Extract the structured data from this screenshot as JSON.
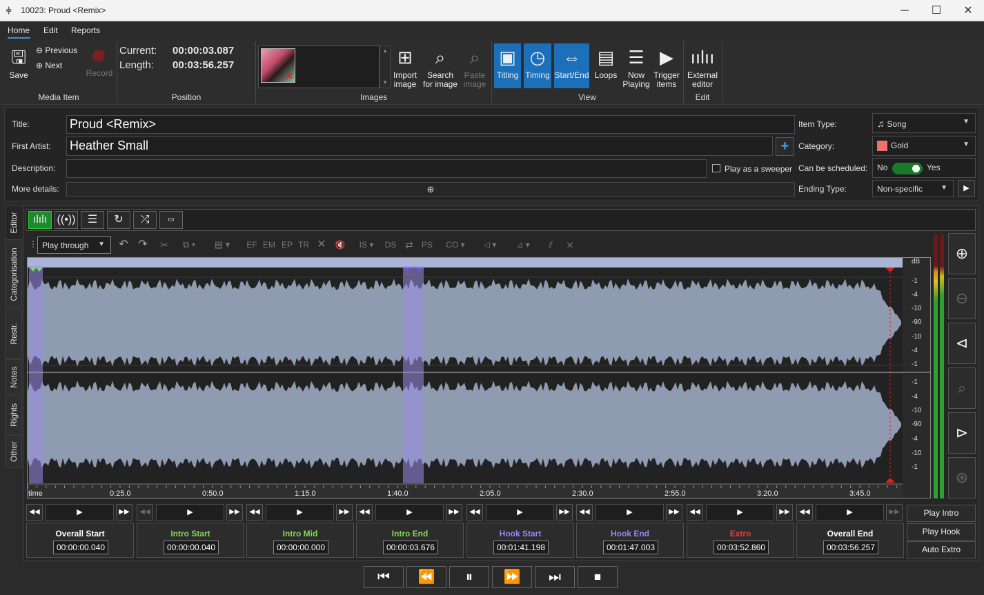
{
  "window": {
    "title": "10023: Proud <Remix>"
  },
  "menu": [
    "Home",
    "Edit",
    "Reports"
  ],
  "ribbon": {
    "save": "Save",
    "previous": "Previous",
    "next": "Next",
    "record": "Record",
    "group_media": "Media Item",
    "current_label": "Current:",
    "current_value": "00:00:03.087",
    "length_label": "Length:",
    "length_value": "00:03:56.257",
    "group_position": "Position",
    "group_images": "Images",
    "import_image": "Import image",
    "search_image": "Search for image",
    "paste_image": "Paste image",
    "titling": "Titling",
    "timing": "Timing",
    "startend": "Start/End",
    "loops": "Loops",
    "now_playing": "Now Playing",
    "trigger_items": "Trigger items",
    "group_view": "View",
    "external_editor": "External editor",
    "group_edit": "Edit"
  },
  "details": {
    "title_label": "Title:",
    "title_value": "Proud <Remix>",
    "artist_label": "First Artist:",
    "artist_value": "Heather Small",
    "description_label": "Description:",
    "description_value": "",
    "more_label": "More details:",
    "sweeper_label": "Play as a sweeper",
    "item_type_label": "Item Type:",
    "item_type_value": "Song",
    "category_label": "Category:",
    "category_value": "Gold",
    "category_color": "#f07070",
    "scheduled_label": "Can be scheduled:",
    "scheduled_no": "No",
    "scheduled_yes": "Yes",
    "ending_label": "Ending Type:",
    "ending_value": "Non-specific"
  },
  "side_tabs": [
    "Editor",
    "Categorisation",
    "Restr.",
    "Notes",
    "Rights",
    "Other"
  ],
  "editor": {
    "play_mode": "Play through",
    "tools": [
      "EF",
      "EM",
      "EP",
      "TR",
      "IS",
      "DS",
      "PS",
      "CO"
    ],
    "db_label": "dB",
    "db_scale": [
      "-1",
      "-4",
      "-10",
      "-90",
      "-10",
      "-4",
      "-1",
      "-1",
      "-4",
      "-10",
      "-90",
      "-10",
      "-4",
      "-1"
    ],
    "time_axis": [
      "time",
      "0:25.0",
      "0:50.0",
      "1:15.0",
      "1:40.0",
      "2:05.0",
      "2:30.0",
      "2:55.0",
      "3:20.0",
      "3:45.0"
    ]
  },
  "markers": [
    {
      "name": "Overall Start",
      "value": "00:00:00.040",
      "color": "#ffffff"
    },
    {
      "name": "Intro Start",
      "value": "00:00:00.040",
      "color": "#86d65a"
    },
    {
      "name": "Intro Mid",
      "value": "00:00:00.000",
      "color": "#86d65a"
    },
    {
      "name": "Intro End",
      "value": "00:00:03.676",
      "color": "#86d65a"
    },
    {
      "name": "Hook Start",
      "value": "00:01:41.198",
      "color": "#9a86f0"
    },
    {
      "name": "Hook End",
      "value": "00:01:47.003",
      "color": "#9a86f0"
    },
    {
      "name": "Extro",
      "value": "00:03:52.860",
      "color": "#f03a3a"
    },
    {
      "name": "Overall End",
      "value": "00:03:56.257",
      "color": "#ffffff"
    }
  ],
  "right_buttons": [
    "Play Intro",
    "Play Hook",
    "Auto Extro"
  ]
}
